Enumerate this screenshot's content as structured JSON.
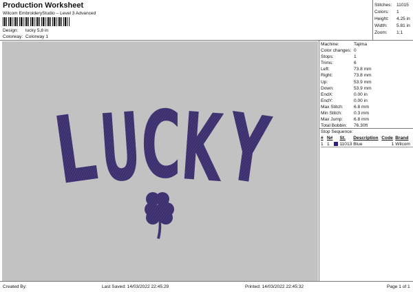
{
  "header": {
    "title": "Production Worksheet",
    "software": "Wilcom EmbroideryStudio – Level 3 Advanced",
    "design_label": "Design:",
    "design_value": "lucky 5,8 in",
    "colorway_label": "Colorway:",
    "colorway_value": "Colorway 1"
  },
  "stats": [
    {
      "label": "Stitches:",
      "value": "11015"
    },
    {
      "label": "Colors:",
      "value": "1"
    },
    {
      "label": "Height:",
      "value": "4.25 in"
    },
    {
      "label": "Width:",
      "value": "5.81 in"
    },
    {
      "label": "Zoom:",
      "value": "1:1"
    }
  ],
  "design": {
    "text": "LUCKY",
    "thread_color": "#3b2f6b",
    "background_color": "#c2c2c2"
  },
  "machine": [
    {
      "label": "Machine:",
      "value": "Tajima"
    },
    {
      "label": "Color changes:",
      "value": "0"
    },
    {
      "label": "Stops:",
      "value": "1"
    },
    {
      "label": "Trims:",
      "value": "6"
    },
    {
      "label": "Left:",
      "value": "73.8 mm"
    },
    {
      "label": "Right:",
      "value": "73.8 mm"
    },
    {
      "label": "Up:",
      "value": "53.9 mm"
    },
    {
      "label": "Down:",
      "value": "53.9 mm"
    },
    {
      "label": "EndX:",
      "value": "0.00 in"
    },
    {
      "label": "EndY:",
      "value": "0.00 in"
    },
    {
      "label": "Max Stitch:",
      "value": "6.8 mm"
    },
    {
      "label": "Min Stitch:",
      "value": "0.3 mm"
    },
    {
      "label": "Max Jump:",
      "value": "6.8 mm"
    },
    {
      "label": "Total Bobbin:",
      "value": "76.30ft"
    }
  ],
  "stop_sequence": {
    "title": "Stop Sequence:",
    "headers": {
      "num": "#",
      "n": "N#",
      "st": "St.",
      "description": "Description",
      "code": "Code",
      "brand": "Brand"
    },
    "rows": [
      {
        "num": "1",
        "n": "1",
        "color": "#2a2080",
        "st": "11013",
        "description": "Blue",
        "code": "1",
        "brand": "Wilcom"
      }
    ]
  },
  "footer": {
    "created_by": "Created By:",
    "last_saved": "Last Saved: 14/03/2022 22:45:29",
    "printed": "Printed: 14/03/2022 22:45:32",
    "page": "Page 1 of 1"
  }
}
